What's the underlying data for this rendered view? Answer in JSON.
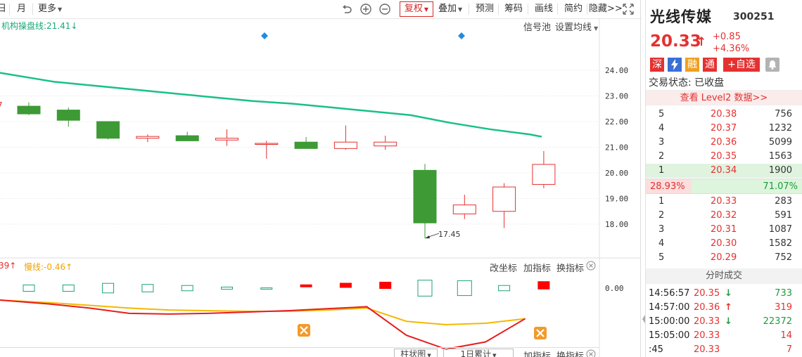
{
  "toolbar": {
    "left_cut": "日",
    "month": "月",
    "more": "更多",
    "fuquan": "复权",
    "diejia": "叠加",
    "yuce": "预测",
    "chouma": "筹码",
    "huaxian": "画线",
    "jianyue": "简约",
    "yincang": "隐藏>>"
  },
  "main_chart": {
    "indicator_label": "机构操盘线:21.41",
    "indicator_arrow": "↓",
    "signal_pool": "信号池",
    "set_ma": "设置均线",
    "low_label": "17.45",
    "y_ticks": [
      "24.00",
      "23.00",
      "22.00",
      "21.00",
      "20.00",
      "19.00",
      "18.00"
    ],
    "left_cut_label": "7"
  },
  "sub_chart": {
    "fast_label": "39",
    "fast_arrow": "↑",
    "slow_label": "慢线:-0.46",
    "slow_arrow": "↑",
    "change_axis": "改坐标",
    "add_indicator": "加指标",
    "switch_indicator": "换指标",
    "y_tick": "0.00"
  },
  "bottom_bar": {
    "chart_type": "柱状图",
    "period": "1日累计",
    "add_indicator": "加指标",
    "switch_indicator": "换指标"
  },
  "stock": {
    "name": "光线传媒",
    "code": "300251",
    "price": "20.33",
    "arrow": "↑",
    "change": "+0.85",
    "change_pct": "+4.36%",
    "badges": [
      "深",
      "融",
      "通"
    ],
    "watchlist": "+自选",
    "trade_status": "交易状态: 已收盘",
    "level2": "查看 Level2 数据>>"
  },
  "order_book": {
    "asks": [
      {
        "level": "5",
        "price": "20.38",
        "vol": "756"
      },
      {
        "level": "4",
        "price": "20.37",
        "vol": "1232"
      },
      {
        "level": "3",
        "price": "20.36",
        "vol": "5099"
      },
      {
        "level": "2",
        "price": "20.35",
        "vol": "1563"
      },
      {
        "level": "1",
        "price": "20.34",
        "vol": "1900"
      }
    ],
    "ratio_left": "28.93%",
    "ratio_right": "71.07%",
    "bids": [
      {
        "level": "1",
        "price": "20.33",
        "vol": "283"
      },
      {
        "level": "2",
        "price": "20.32",
        "vol": "591"
      },
      {
        "level": "3",
        "price": "20.31",
        "vol": "1087"
      },
      {
        "level": "4",
        "price": "20.30",
        "vol": "1582"
      },
      {
        "level": "5",
        "price": "20.29",
        "vol": "752"
      }
    ]
  },
  "time_sales": {
    "title": "分时成交",
    "rows": [
      {
        "time": "14:56:57",
        "price": "20.35",
        "arrow": "↓",
        "vol": "733",
        "dir": "down"
      },
      {
        "time": "14:57:00",
        "price": "20.36",
        "arrow": "↑",
        "vol": "319",
        "dir": "up"
      },
      {
        "time": "15:00:00",
        "price": "20.33",
        "arrow": "↓",
        "vol": "22372",
        "dir": "down"
      },
      {
        "time": "15:05:00",
        "price": "20.33",
        "arrow": "",
        "vol": "14",
        "dir": "flat"
      },
      {
        "time": ":45",
        "price": "20.33",
        "arrow": "",
        "vol": "7",
        "dir": "flat"
      }
    ]
  },
  "colors": {
    "up": "#e53030",
    "down": "#3d9a35",
    "ma_line": "#19c08a",
    "accent_blue": "#1e8ce0"
  },
  "chart_data": {
    "type": "candlestick",
    "candles": [
      {
        "o": 22.6,
        "h": 22.75,
        "l": 22.25,
        "c": 22.3
      },
      {
        "o": 22.45,
        "h": 22.55,
        "l": 21.8,
        "c": 22.05
      },
      {
        "o": 22.0,
        "h": 22.0,
        "l": 21.3,
        "c": 21.35
      },
      {
        "o": 21.35,
        "h": 21.5,
        "l": 21.2,
        "c": 21.42
      },
      {
        "o": 21.45,
        "h": 21.6,
        "l": 21.25,
        "c": 21.25
      },
      {
        "o": 21.28,
        "h": 21.7,
        "l": 21.05,
        "c": 21.35
      },
      {
        "o": 21.15,
        "h": 21.25,
        "l": 20.55,
        "c": 21.15
      },
      {
        "o": 21.2,
        "h": 21.4,
        "l": 20.95,
        "c": 20.95
      },
      {
        "o": 20.95,
        "h": 21.85,
        "l": 20.9,
        "c": 21.2
      },
      {
        "o": 21.05,
        "h": 21.45,
        "l": 20.9,
        "c": 21.2
      },
      {
        "o": 20.1,
        "h": 20.35,
        "l": 17.45,
        "c": 18.05
      },
      {
        "o": 18.4,
        "h": 19.15,
        "l": 18.2,
        "c": 18.75
      },
      {
        "o": 18.5,
        "h": 19.6,
        "l": 17.85,
        "c": 19.45
      },
      {
        "o": 19.55,
        "h": 20.85,
        "l": 19.4,
        "c": 20.33
      }
    ],
    "ma_line": [
      23.9,
      23.55,
      23.4,
      23.25,
      23.1,
      22.95,
      22.8,
      22.7,
      22.55,
      22.4,
      22.25,
      21.95,
      21.7,
      21.5,
      21.41
    ],
    "ylim": [
      17.0,
      25.0
    ],
    "macd_bars": [
      0.06,
      0.06,
      0.09,
      0.07,
      0.05,
      0.02,
      0.005,
      -0.01,
      -0.04,
      -0.06,
      0.15,
      0.14,
      0.05,
      -0.07
    ],
    "macd_fast": [
      -0.18,
      -0.24,
      -0.3,
      -0.38,
      -0.39,
      -0.38,
      -0.36,
      -0.34,
      -0.31,
      -0.28,
      -0.71,
      -0.92,
      -0.81,
      -0.46
    ],
    "macd_slow": [
      -0.18,
      -0.22,
      -0.26,
      -0.3,
      -0.33,
      -0.34,
      -0.35,
      -0.35,
      -0.33,
      -0.3,
      -0.5,
      -0.55,
      -0.53,
      -0.46
    ],
    "macd_ylim": [
      -0.95,
      0.3
    ]
  }
}
